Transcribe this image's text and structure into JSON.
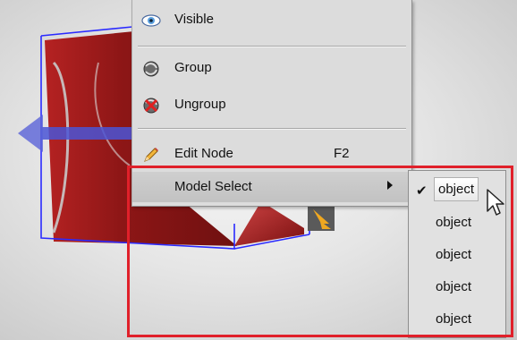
{
  "menu": {
    "items": [
      {
        "label": "Visible",
        "icon": "eye-icon"
      },
      {
        "label": "Group",
        "icon": "group-icon"
      },
      {
        "label": "Ungroup",
        "icon": "ungroup-icon"
      },
      {
        "label": "Edit Node",
        "icon": "pencil-icon",
        "shortcut": "F2"
      },
      {
        "label": "Model Select",
        "icon": "submenu-arrow-icon"
      }
    ]
  },
  "submenu": {
    "items": [
      {
        "label": "object",
        "checked": true
      },
      {
        "label": "object",
        "checked": false
      },
      {
        "label": "object",
        "checked": false
      },
      {
        "label": "object",
        "checked": false
      },
      {
        "label": "object",
        "checked": false
      }
    ],
    "check_glyph": "✔"
  },
  "colors": {
    "highlight_border": "#e0202a",
    "model_red": "#9b1d1d",
    "bbox_blue": "#2a2aff",
    "manipulator_blue": "#5a63d8"
  }
}
